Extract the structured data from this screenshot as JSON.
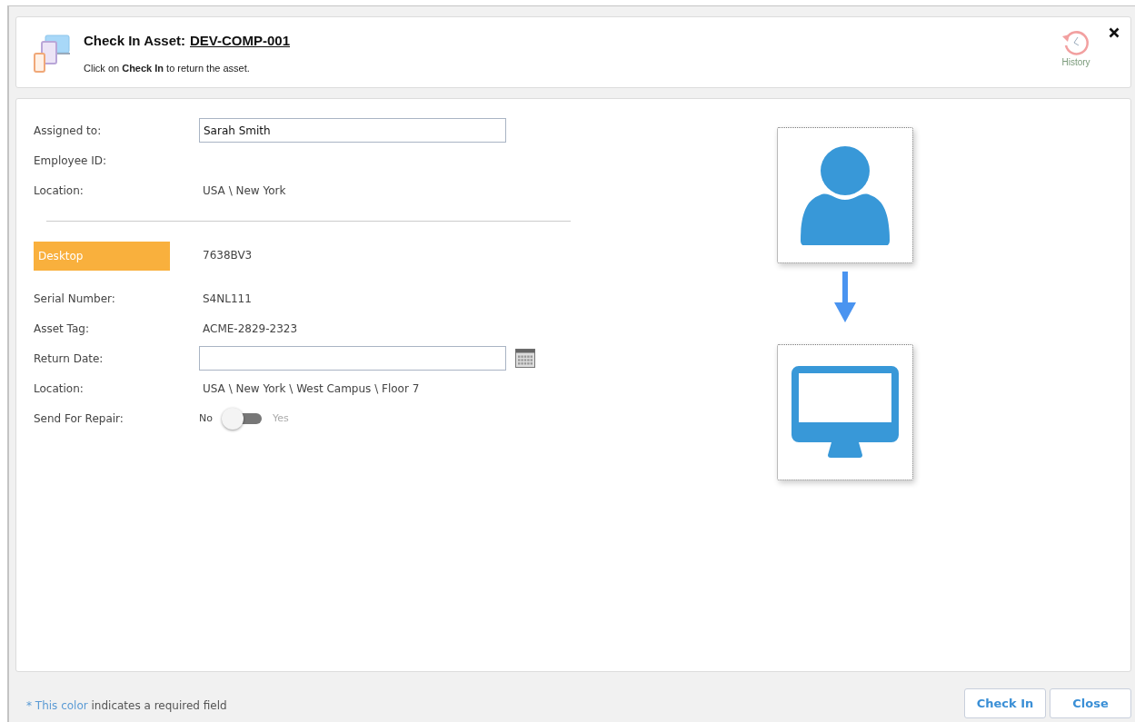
{
  "header": {
    "title_prefix": "Check In Asset:",
    "asset_id": "DEV-COMP-001",
    "instruction": "Click on **Check In** to return the asset.",
    "history_label": "History"
  },
  "assignee_fields": [
    {
      "kind": "input",
      "label": "Assigned to:",
      "value": "Sarah Smith"
    },
    {
      "kind": "text",
      "label": "Employee ID:"
    },
    {
      "kind": "text",
      "label": "Location:",
      "value": "USA \\ New York"
    }
  ],
  "asset_fields": [
    {
      "kind": "badge",
      "label": "Desktop",
      "value": "7638BV3"
    },
    {
      "kind": "text",
      "label": "Serial Number:",
      "value": "S4NL111"
    },
    {
      "kind": "text",
      "label": "Asset Tag:",
      "value": "ACME-2829-2323"
    },
    {
      "kind": "date",
      "label": "Return Date:"
    },
    {
      "kind": "text",
      "label": "Location:",
      "value": "USA \\ New York \\ West Campus \\ Floor 7"
    },
    {
      "kind": "toggle",
      "label": "Send For Repair:",
      "off_label": "No",
      "on_label": "Yes",
      "on": false
    }
  ],
  "footer": {
    "note_highlight": "* This color",
    "note_rest": "indicates a required field"
  },
  "buttons": [
    "Check In",
    "Close"
  ]
}
